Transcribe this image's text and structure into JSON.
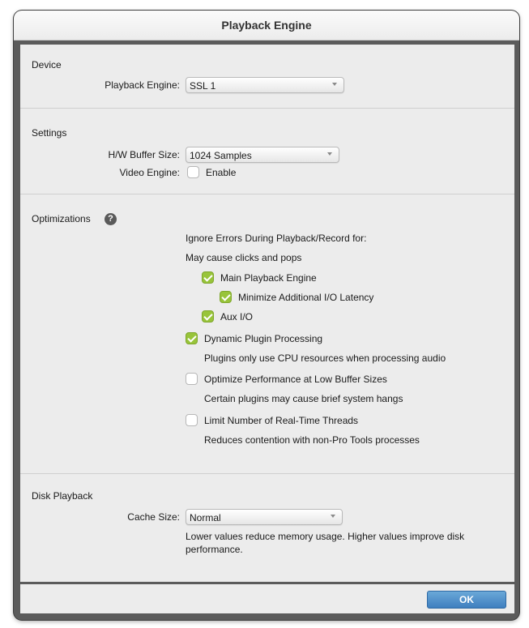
{
  "window": {
    "title": "Playback Engine"
  },
  "device": {
    "section_title": "Device",
    "playback_engine_label": "Playback Engine:",
    "playback_engine_value": "SSL 1"
  },
  "settings": {
    "section_title": "Settings",
    "buffer_label": "H/W Buffer Size:",
    "buffer_value": "1024 Samples",
    "video_label": "Video Engine:",
    "video_enable_label": "Enable",
    "video_enable_checked": false
  },
  "optimizations": {
    "section_title": "Optimizations",
    "help_icon_glyph": "?",
    "ignore_errors_heading": "Ignore Errors During Playback/Record for:",
    "ignore_errors_note": "May cause clicks and pops",
    "main_playback_engine": {
      "label": "Main Playback Engine",
      "checked": true
    },
    "minimize_latency": {
      "label": "Minimize Additional I/O Latency",
      "checked": true
    },
    "aux_io": {
      "label": "Aux I/O",
      "checked": true
    },
    "dynamic_plugin": {
      "label": "Dynamic Plugin Processing",
      "checked": true,
      "desc": "Plugins only use CPU resources when processing audio"
    },
    "optimize_low_buffer": {
      "label": "Optimize Performance at Low Buffer Sizes",
      "checked": false,
      "desc": "Certain plugins may cause brief system hangs"
    },
    "limit_threads": {
      "label": "Limit Number of Real-Time Threads",
      "checked": false,
      "desc": "Reduces contention with non-Pro Tools processes"
    }
  },
  "disk_playback": {
    "section_title": "Disk Playback",
    "cache_label": "Cache Size:",
    "cache_value": "Normal",
    "cache_note_line1": "Lower values reduce memory usage. Higher values improve disk",
    "cache_note_line2": "performance."
  },
  "footer": {
    "ok_label": "OK"
  },
  "colors": {
    "check_accent": "#98c43a",
    "ok_button": "#4a8ccc",
    "frame": "#5b5b5b"
  },
  "icons": {
    "help": "help-icon",
    "dropdown": "chevron-down-icon",
    "check": "checkmark-icon"
  }
}
